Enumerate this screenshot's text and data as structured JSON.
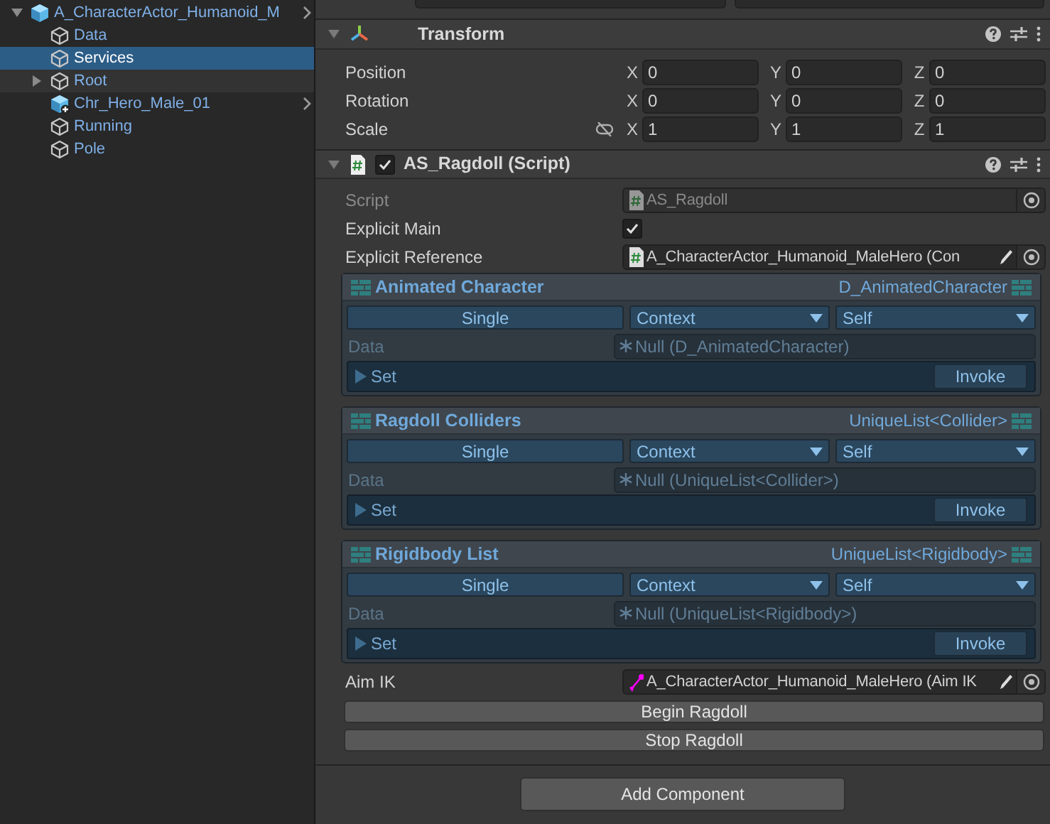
{
  "hierarchy": {
    "items": [
      {
        "label": "A_CharacterActor_Humanoid_M",
        "kind": "prefab",
        "expanded": true,
        "selected": false,
        "has_chevron": true,
        "children": [
          {
            "label": "Data",
            "kind": "object",
            "selected": false
          },
          {
            "label": "Services",
            "kind": "object",
            "selected": true
          },
          {
            "label": "Root",
            "kind": "object",
            "selected": false,
            "expanded": false
          },
          {
            "label": "Chr_Hero_Male_01",
            "kind": "prefab_variant",
            "selected": false,
            "has_chevron": true
          },
          {
            "label": "Running",
            "kind": "object",
            "selected": false
          },
          {
            "label": "Pole",
            "kind": "object",
            "selected": false
          }
        ]
      }
    ]
  },
  "transform": {
    "title": "Transform",
    "expanded": true,
    "rows": [
      {
        "label": "Position",
        "axes": [
          {
            "axis": "X",
            "value": "0"
          },
          {
            "axis": "Y",
            "value": "0"
          },
          {
            "axis": "Z",
            "value": "0"
          }
        ]
      },
      {
        "label": "Rotation",
        "axes": [
          {
            "axis": "X",
            "value": "0"
          },
          {
            "axis": "Y",
            "value": "0"
          },
          {
            "axis": "Z",
            "value": "0"
          }
        ]
      },
      {
        "label": "Scale",
        "linked": false,
        "axes": [
          {
            "axis": "X",
            "value": "1"
          },
          {
            "axis": "Y",
            "value": "1"
          },
          {
            "axis": "Z",
            "value": "1"
          }
        ]
      }
    ]
  },
  "script_component": {
    "title": "AS_Ragdoll (Script)",
    "enabled": true,
    "expanded": true,
    "script": {
      "label": "Script",
      "value": "AS_Ragdoll",
      "disabled": true
    },
    "explicit_main": {
      "label": "Explicit Main",
      "checked": true
    },
    "explicit_reference": {
      "label": "Explicit Reference",
      "value": "A_CharacterActor_Humanoid_MaleHero (Con"
    },
    "data_blocks": [
      {
        "title": "Animated Character",
        "type": "D_AnimatedCharacter",
        "mode": "Single",
        "source": "Context",
        "target": "Self",
        "data_label": "Data",
        "data_value": "Null (D_AnimatedCharacter)",
        "set_label": "Set",
        "invoke": "Invoke"
      },
      {
        "title": "Ragdoll Colliders",
        "type": "UniqueList<Collider>",
        "mode": "Single",
        "source": "Context",
        "target": "Self",
        "data_label": "Data",
        "data_value": "Null (UniqueList<Collider>)",
        "set_label": "Set",
        "invoke": "Invoke"
      },
      {
        "title": "Rigidbody List",
        "type": "UniqueList<Rigidbody>",
        "mode": "Single",
        "source": "Context",
        "target": "Self",
        "data_label": "Data",
        "data_value": "Null (UniqueList<Rigidbody>)",
        "set_label": "Set",
        "invoke": "Invoke"
      }
    ],
    "aim_ik": {
      "label": "Aim IK",
      "value": "A_CharacterActor_Humanoid_MaleHero (Aim IK"
    },
    "buttons": [
      "Begin Ragdoll",
      "Stop Ragdoll"
    ]
  },
  "add_component": "Add Component"
}
